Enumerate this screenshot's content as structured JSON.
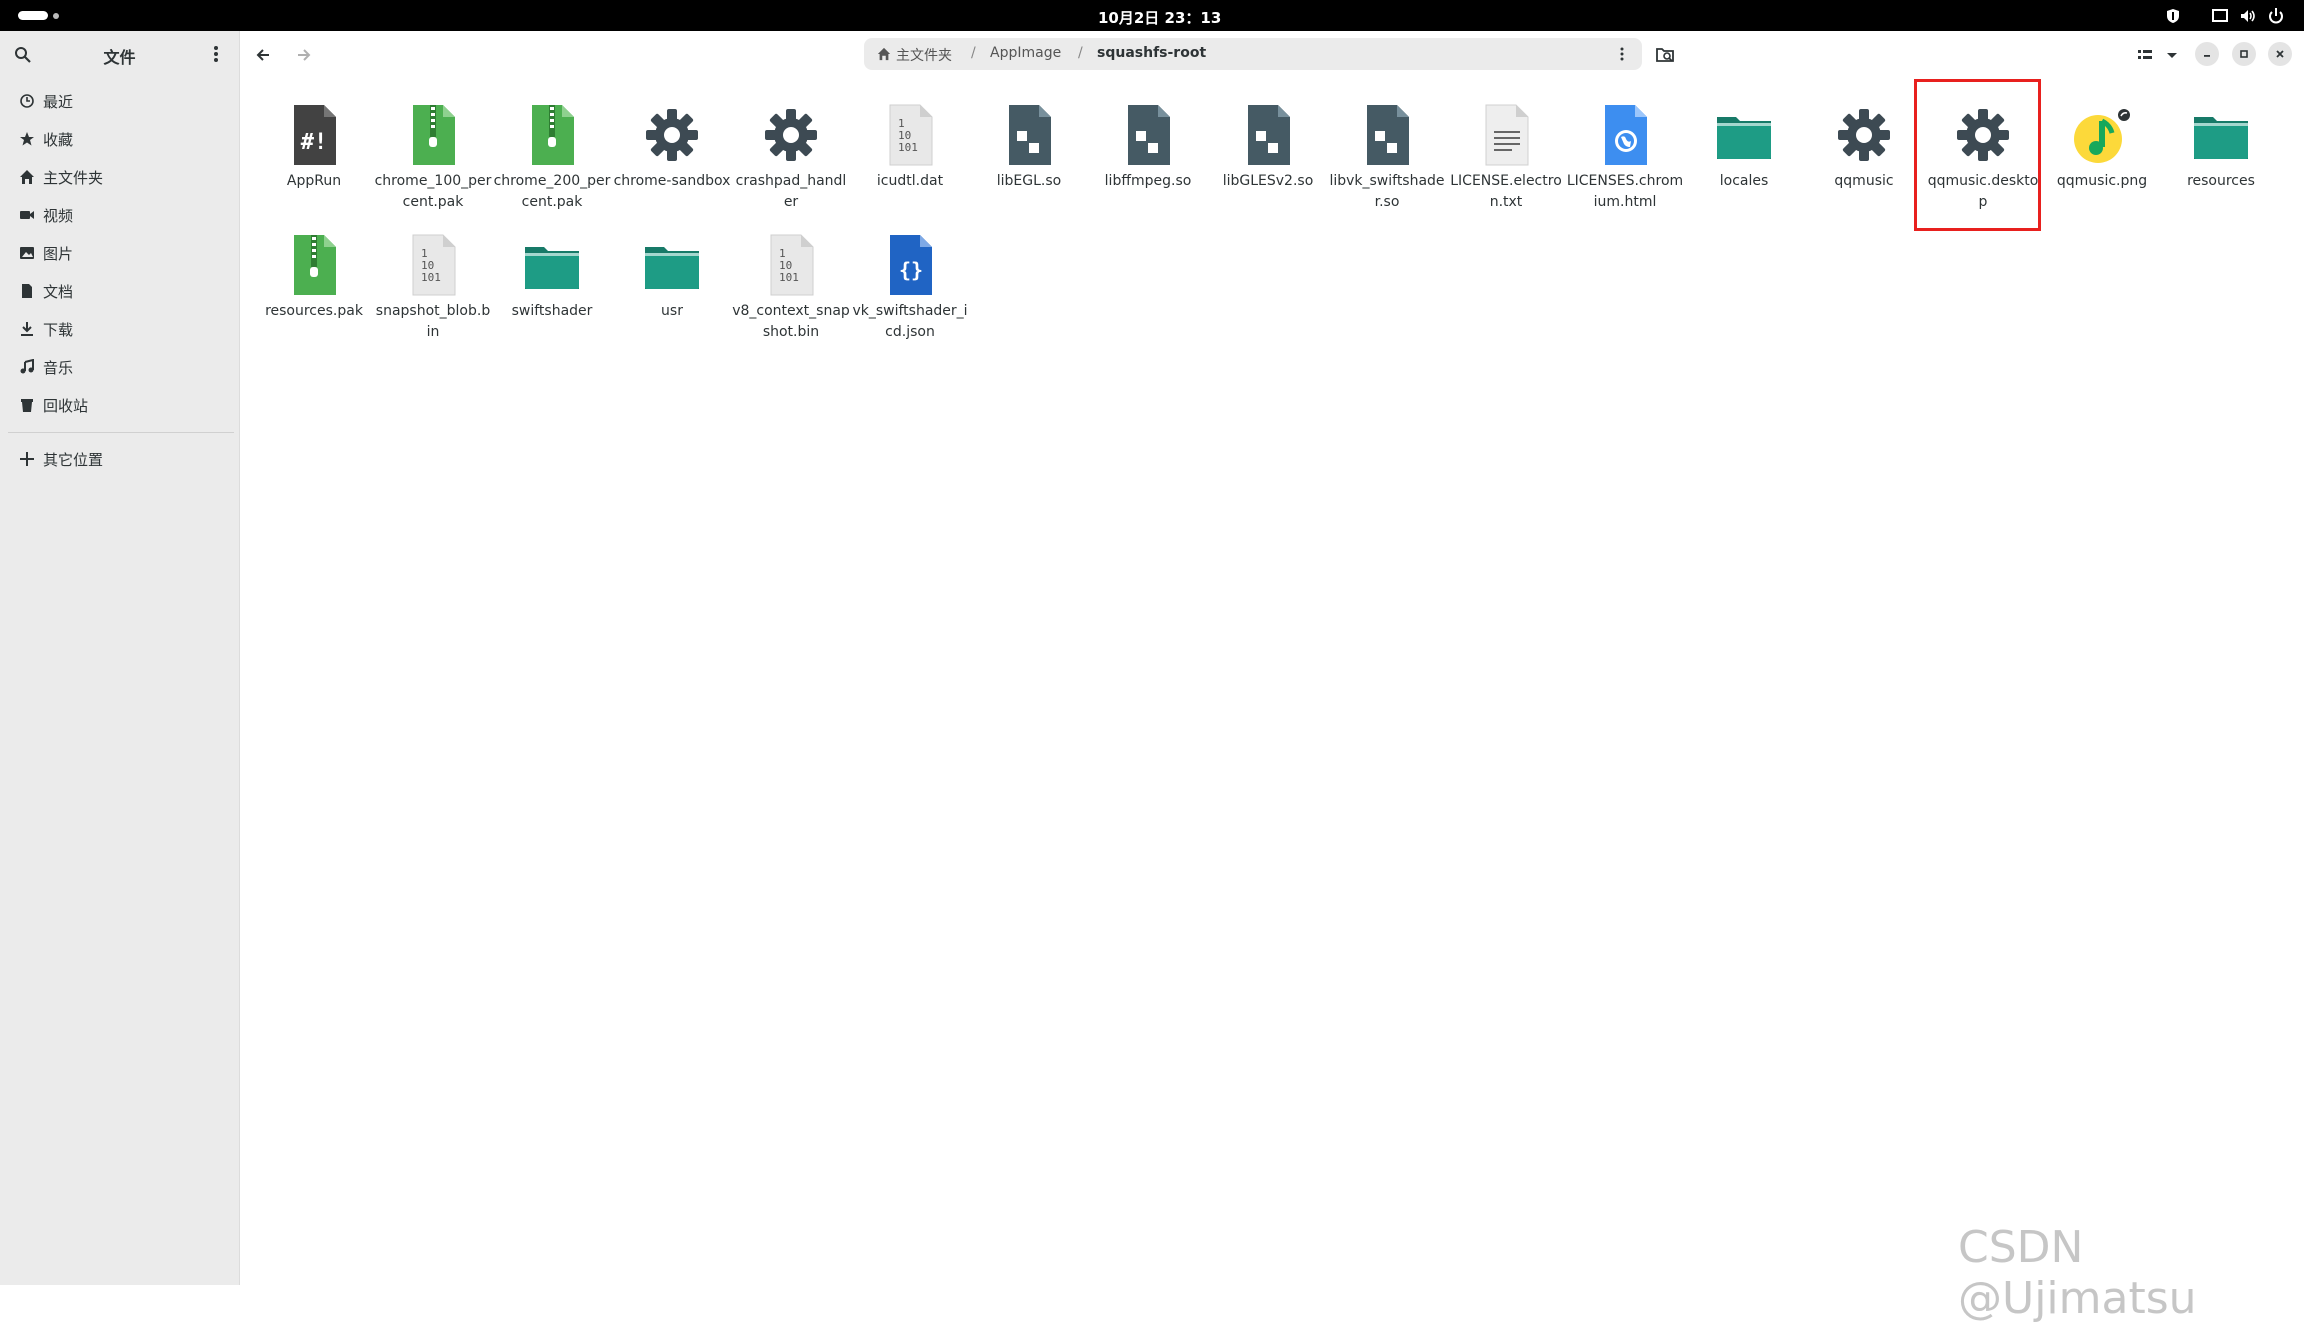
{
  "topbar": {
    "clock": "10月2日  23：13"
  },
  "sidebar": {
    "title": "文件",
    "items": [
      {
        "label": "最近",
        "icon": "clock-icon"
      },
      {
        "label": "收藏",
        "icon": "star-icon"
      },
      {
        "label": "主文件夹",
        "icon": "home-icon"
      },
      {
        "label": "视频",
        "icon": "video-icon"
      },
      {
        "label": "图片",
        "icon": "image-icon"
      },
      {
        "label": "文档",
        "icon": "document-icon"
      },
      {
        "label": "下载",
        "icon": "download-icon"
      },
      {
        "label": "音乐",
        "icon": "music-icon"
      },
      {
        "label": "回收站",
        "icon": "trash-icon"
      }
    ],
    "other": {
      "label": "其它位置",
      "icon": "plus-icon"
    }
  },
  "path": {
    "crumbs": [
      "主文件夹",
      "AppImage",
      "squashfs-root"
    ]
  },
  "files": [
    {
      "name": "AppRun",
      "icon": "script-file-icon"
    },
    {
      "name": "chrome_100_percent.pak",
      "icon": "archive-icon"
    },
    {
      "name": "chrome_200_percent.pak",
      "icon": "archive-icon"
    },
    {
      "name": "chrome-sandbox",
      "icon": "executable-gear-icon"
    },
    {
      "name": "crashpad_handler",
      "icon": "executable-gear-icon"
    },
    {
      "name": "icudtl.dat",
      "icon": "binary-file-icon"
    },
    {
      "name": "libEGL.so",
      "icon": "library-icon"
    },
    {
      "name": "libffmpeg.so",
      "icon": "library-icon"
    },
    {
      "name": "libGLESv2.so",
      "icon": "library-icon"
    },
    {
      "name": "libvk_swiftshader.so",
      "icon": "library-icon"
    },
    {
      "name": "LICENSE.electron.txt",
      "icon": "text-file-icon"
    },
    {
      "name": "LICENSES.chromium.html",
      "icon": "html-file-icon"
    },
    {
      "name": "locales",
      "icon": "folder-icon"
    },
    {
      "name": "qqmusic",
      "icon": "executable-gear-icon"
    },
    {
      "name": "qqmusic.desktop",
      "icon": "executable-gear-icon"
    },
    {
      "name": "qqmusic.png",
      "icon": "qqmusic-image-icon"
    },
    {
      "name": "resources",
      "icon": "folder-icon"
    },
    {
      "name": "resources.pak",
      "icon": "archive-icon"
    },
    {
      "name": "snapshot_blob.bin",
      "icon": "binary-file-icon"
    },
    {
      "name": "swiftshader",
      "icon": "folder-icon"
    },
    {
      "name": "usr",
      "icon": "folder-icon"
    },
    {
      "name": "v8_context_snapshot.bin",
      "icon": "binary-file-icon"
    },
    {
      "name": "vk_swiftshader_icd.json",
      "icon": "json-file-icon"
    }
  ],
  "watermark": "CSDN @Ujimatsu",
  "colors": {
    "folder": "#1e9c85",
    "archive": "#4caf50",
    "gear": "#3d4a53",
    "json": "#2064c4",
    "highlight": "#e8201e"
  }
}
